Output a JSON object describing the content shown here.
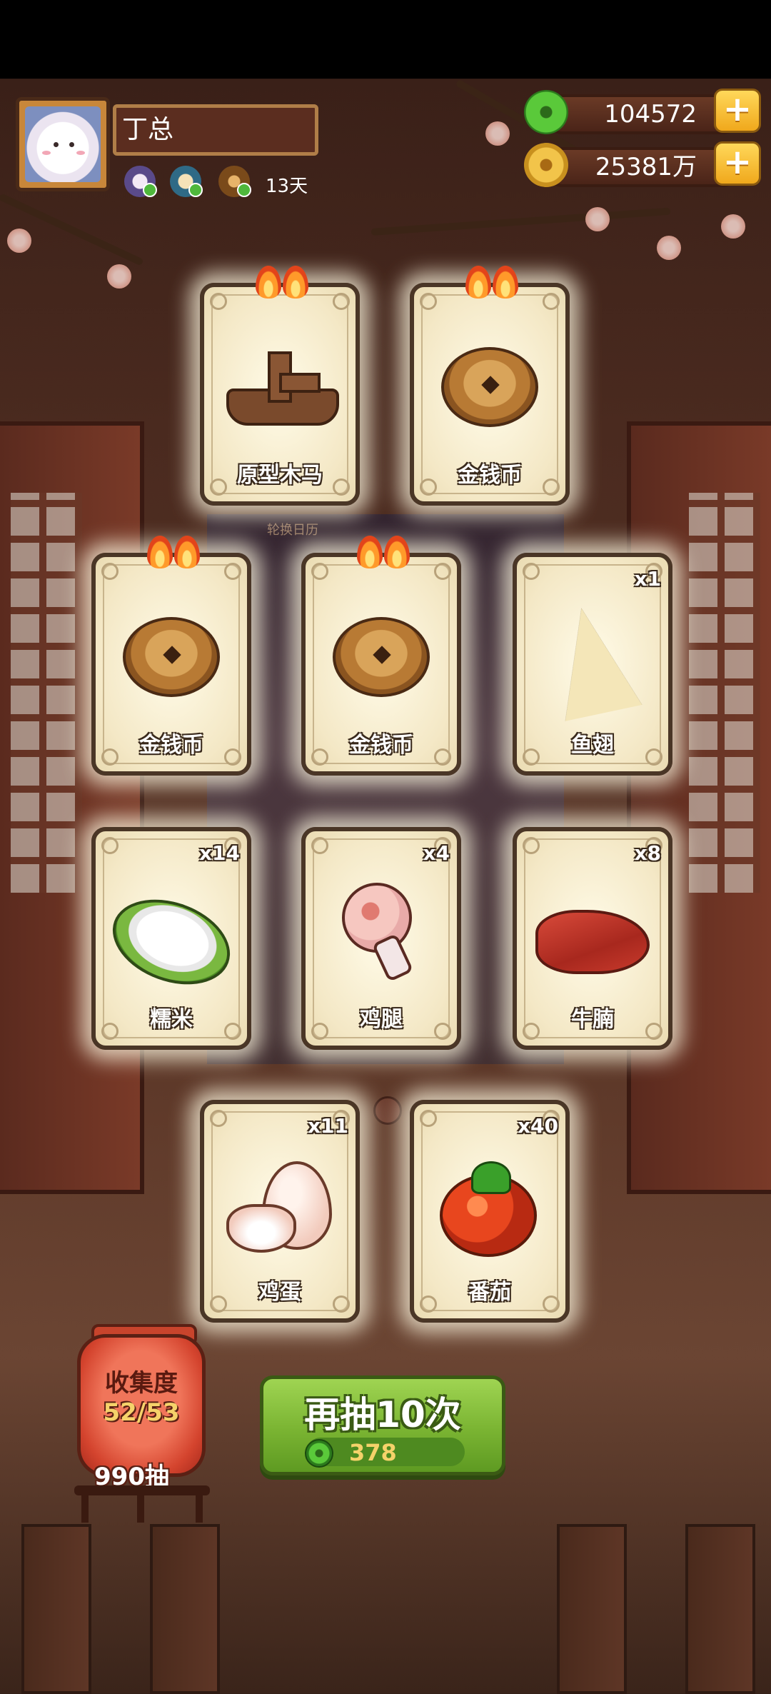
{
  "profile": {
    "name": "丁总",
    "days": "13天"
  },
  "currency": {
    "jade": "104572",
    "coins": "25381万",
    "plus": "+"
  },
  "background": {
    "calendar_label": "轮换日历"
  },
  "cards": [
    {
      "label": "原型木马",
      "qty": "",
      "flames": true,
      "icon": "wooden-horse-icon"
    },
    {
      "label": "金钱币",
      "qty": "",
      "flames": true,
      "icon": "coin-icon"
    },
    {
      "label": "金钱币",
      "qty": "",
      "flames": true,
      "icon": "coin-icon"
    },
    {
      "label": "金钱币",
      "qty": "",
      "flames": true,
      "icon": "coin-icon"
    },
    {
      "label": "鱼翅",
      "qty": "x1",
      "flames": false,
      "icon": "shark-fin-icon"
    },
    {
      "label": "糯米",
      "qty": "x14",
      "flames": false,
      "icon": "sticky-rice-icon"
    },
    {
      "label": "鸡腿",
      "qty": "x4",
      "flames": false,
      "icon": "chicken-leg-icon"
    },
    {
      "label": "牛腩",
      "qty": "x8",
      "flames": false,
      "icon": "beef-brisket-icon"
    },
    {
      "label": "鸡蛋",
      "qty": "x11",
      "flames": false,
      "icon": "egg-icon"
    },
    {
      "label": "番茄",
      "qty": "x40",
      "flames": false,
      "icon": "tomato-icon"
    }
  ],
  "collection": {
    "title": "收集度",
    "progress": "52/53",
    "draws": "990抽"
  },
  "draw_button": {
    "label": "再抽10次",
    "cost": "378"
  }
}
